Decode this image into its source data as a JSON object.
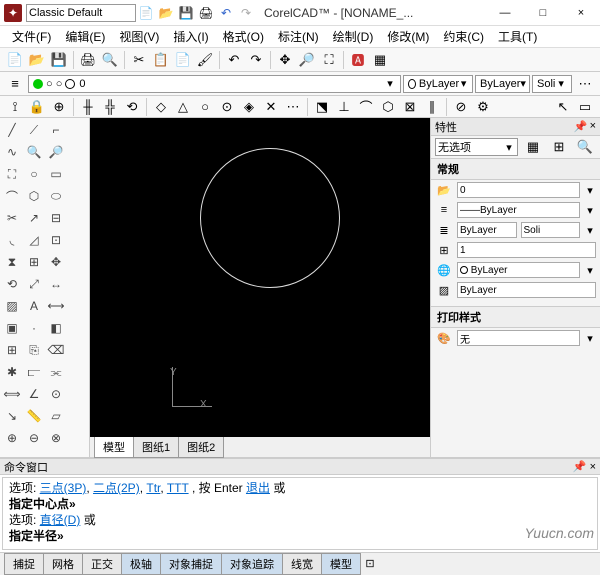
{
  "title": {
    "workspace": "Classic Default",
    "app": "CorelCAD™ - [NONAME_..."
  },
  "win": {
    "min": "—",
    "max": "□",
    "close": "×"
  },
  "menu": [
    "文件(F)",
    "编辑(E)",
    "视图(V)",
    "插入(I)",
    "格式(O)",
    "标注(N)",
    "绘制(D)",
    "修改(M)",
    "约束(C)",
    "工具(T)"
  ],
  "layer": {
    "current": "0",
    "color_combo": "ByLayer",
    "line_combo": "ByLayer",
    "style_combo": "Soli"
  },
  "tabs": {
    "model": "模型",
    "sheet1": "图纸1",
    "sheet2": "图纸2"
  },
  "props": {
    "title": "特性",
    "selection": "无选项",
    "group_general": "常规",
    "layer": "0",
    "ltype": "ByLayer",
    "lcolor_label": "ByLayer",
    "lstyle_val": "Soli",
    "lweight": "1",
    "color2": "ByLayer",
    "hatch": "ByLayer",
    "group_plot": "打印样式",
    "plot_val": "无"
  },
  "cmd": {
    "title": "命令窗口",
    "line1_prefix": "选项: ",
    "line1_links": [
      "三点(3P)",
      "二点(2P)",
      "Ttr",
      "TTT"
    ],
    "line1_mid": ", 按 Enter",
    "line1_link_exit": "退出",
    "line1_suffix": "或",
    "line2": "指定中心点»",
    "line3_prefix": "选项: ",
    "line3_link": "直径(D)",
    "line3_suffix": " 或",
    "line4": "指定半径»"
  },
  "status": [
    "捕捉",
    "网格",
    "正交",
    "极轴",
    "对象捕捉",
    "对象追踪",
    "线宽",
    "模型"
  ],
  "watermark": "Yuucn.com"
}
